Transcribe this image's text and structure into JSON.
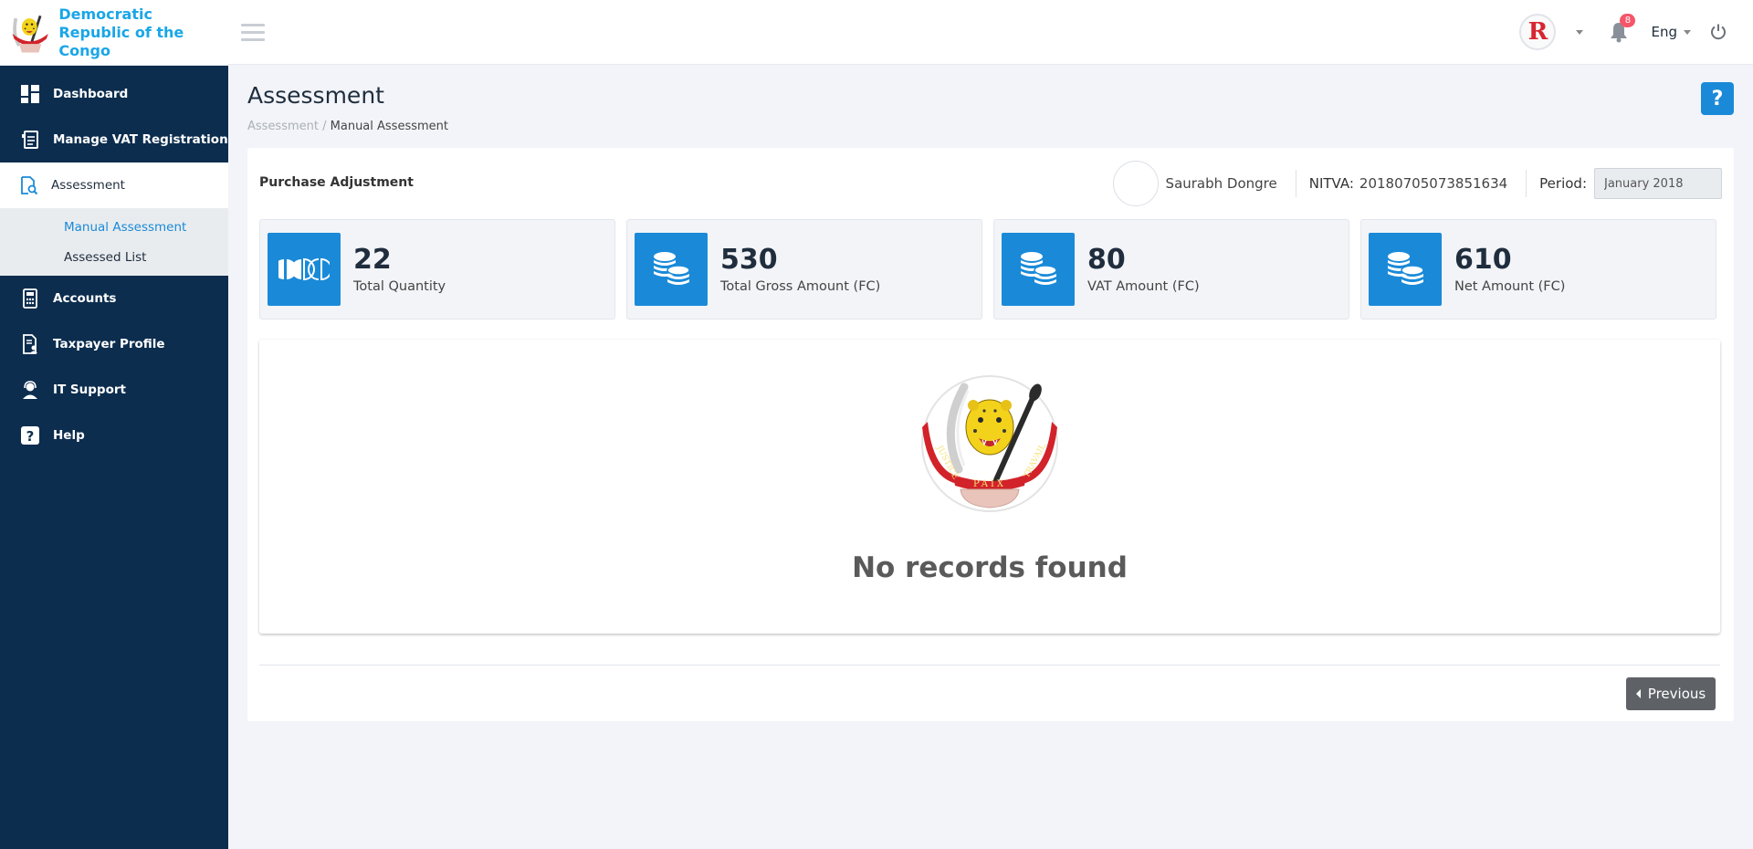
{
  "brand": {
    "line1": "Democratic",
    "line2": "Republic of the Congo"
  },
  "sidebar": {
    "items": [
      {
        "label": "Dashboard",
        "icon": "dashboard-icon"
      },
      {
        "label": "Manage VAT Registration",
        "icon": "document-icon"
      },
      {
        "label": "Assessment",
        "icon": "assessment-icon",
        "active": true
      },
      {
        "label": "Accounts",
        "icon": "calculator-icon"
      },
      {
        "label": "Taxpayer Profile",
        "icon": "profile-icon"
      },
      {
        "label": "IT Support",
        "icon": "support-icon"
      },
      {
        "label": "Help",
        "icon": "help-icon"
      }
    ],
    "subitems": [
      {
        "label": "Manual Assessment",
        "current": true
      },
      {
        "label": "Assessed List"
      }
    ]
  },
  "topbar": {
    "avatar_letter": "R",
    "notification_count": "8",
    "language": "Eng"
  },
  "page": {
    "title": "Assessment",
    "breadcrumb_parent": "Assessment",
    "breadcrumb_sep": " / ",
    "breadcrumb_current": "Manual Assessment",
    "help_label": "?"
  },
  "panel": {
    "section_title": "Purchase Adjustment",
    "user_name": "Saurabh Dongre",
    "nitva_label": "NITVA:",
    "nitva_value": "20180705073851634",
    "period_label": "Period:",
    "period_value": "January 2018"
  },
  "stats": [
    {
      "value": "22",
      "label": "Total Quantity",
      "icon": "quantity-icon"
    },
    {
      "value": "530",
      "label": "Total Gross Amount (FC)",
      "icon": "coins-icon"
    },
    {
      "value": "80",
      "label": "VAT Amount (FC)",
      "icon": "coins-icon"
    },
    {
      "value": "610",
      "label": "Net Amount (FC)",
      "icon": "coins-icon"
    }
  ],
  "empty_state": {
    "message": "No records found",
    "emblem_left": "JUSTICE",
    "emblem_right": "TRAVAIL",
    "emblem_bottom": "PAIX"
  },
  "pagination": {
    "previous_label": "Previous"
  },
  "colors": {
    "sidebar_bg": "#0c2d4e",
    "accent": "#1a8ad8",
    "brand_text": "#1aa6e8",
    "badge": "#f5566a"
  }
}
